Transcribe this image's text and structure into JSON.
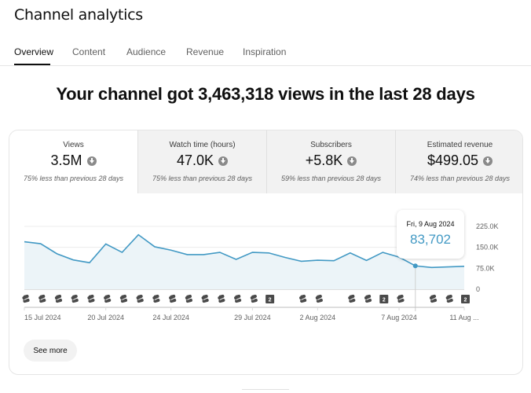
{
  "header": {
    "title": "Channel analytics"
  },
  "tabs": [
    {
      "label": "Overview",
      "active": true
    },
    {
      "label": "Content",
      "active": false
    },
    {
      "label": "Audience",
      "active": false
    },
    {
      "label": "Revenue",
      "active": false
    },
    {
      "label": "Inspiration",
      "active": false
    }
  ],
  "headline": "Your channel got 3,463,318 views in the last 28 days",
  "metrics": [
    {
      "label": "Views",
      "value": "3.5M",
      "trend_icon": "arrow-down-circle-icon",
      "compare": "75% less than previous 28 days"
    },
    {
      "label": "Watch time (hours)",
      "value": "47.0K",
      "trend_icon": "arrow-down-circle-icon",
      "compare": "75% less than previous 28 days"
    },
    {
      "label": "Subscribers",
      "value": "+5.8K",
      "trend_icon": "arrow-down-circle-icon",
      "compare": "59% less than previous 28 days"
    },
    {
      "label": "Estimated revenue",
      "value": "$499.05",
      "trend_icon": "arrow-down-circle-icon",
      "compare": "74% less than previous 28 days"
    }
  ],
  "tooltip": {
    "date": "Fri, 9 Aug 2024",
    "value": "83,702"
  },
  "see_more_label": "See more",
  "colors": {
    "line": "#4299c4",
    "area": "#ecf4f8",
    "tooltip_value": "#4299c4"
  },
  "chart_data": {
    "type": "area",
    "title": "Views",
    "xlabel": "",
    "ylabel": "",
    "ylim": [
      0,
      225000
    ],
    "y_ticks": [
      "0",
      "75.0K",
      "150.0K",
      "225.0K"
    ],
    "y_tick_values": [
      0,
      75000,
      150000,
      225000
    ],
    "x_tick_labels": [
      {
        "label": "15 Jul 2024",
        "index": 0
      },
      {
        "label": "20 Jul 2024",
        "index": 5
      },
      {
        "label": "24 Jul 2024",
        "index": 9
      },
      {
        "label": "29 Jul 2024",
        "index": 14
      },
      {
        "label": "2 Aug 2024",
        "index": 18
      },
      {
        "label": "7 Aug 2024",
        "index": 23
      },
      {
        "label": "11 Aug ...",
        "index": 27
      }
    ],
    "grid": true,
    "series": [
      {
        "name": "Views",
        "values": [
          170000,
          163000,
          127000,
          105000,
          95000,
          162000,
          132000,
          195000,
          152000,
          140000,
          124000,
          124000,
          132000,
          107000,
          132000,
          130000,
          114000,
          100000,
          104000,
          102000,
          130000,
          103000,
          132000,
          115000,
          83702,
          78000,
          80000,
          82000
        ]
      }
    ],
    "highlight": {
      "index": 24,
      "date": "Fri, 9 Aug 2024",
      "value": 83702
    },
    "markers": [
      "short",
      "short",
      "short",
      "short",
      "short",
      "short",
      "short",
      "short",
      "short",
      "short",
      "short",
      "short",
      "short",
      "short",
      "short",
      "2",
      "",
      "short",
      "short",
      "",
      "short",
      "short",
      "2",
      "short",
      "",
      "short",
      "short",
      "2"
    ]
  }
}
